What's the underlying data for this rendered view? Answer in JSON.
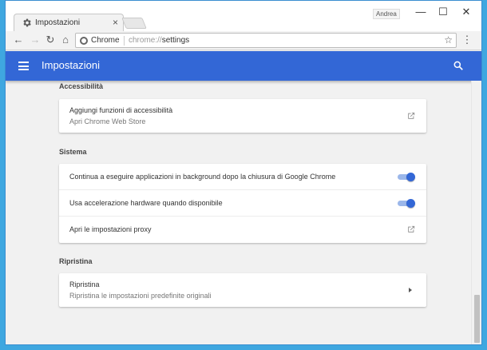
{
  "tab": {
    "title": "Impostazioni",
    "close": "×"
  },
  "window": {
    "profile": "Andrea",
    "minimize": "—",
    "maximize": "☐",
    "close": "✕"
  },
  "toolbar": {
    "back": "←",
    "forward": "→",
    "reload": "↻",
    "home": "⌂",
    "menu": "⋮"
  },
  "omnibox": {
    "site_name": "Chrome",
    "url_scheme": "chrome://",
    "url_path": "settings",
    "star": "☆"
  },
  "appbar": {
    "title": "Impostazioni"
  },
  "sections": {
    "accessibility": {
      "title": "Accessibilità",
      "item": {
        "label": "Aggiungi funzioni di accessibilità",
        "sub": "Apri Chrome Web Store"
      }
    },
    "system": {
      "title": "Sistema",
      "items": [
        {
          "label": "Continua a eseguire applicazioni in background dopo la chiusura di Google Chrome",
          "enabled": true
        },
        {
          "label": "Usa accelerazione hardware quando disponibile",
          "enabled": true
        },
        {
          "label": "Apri le impostazioni proxy"
        }
      ]
    },
    "reset": {
      "title": "Ripristina",
      "item": {
        "label": "Ripristina",
        "sub": "Ripristina le impostazioni predefinite originali"
      }
    }
  },
  "colors": {
    "accent": "#3367d6",
    "toggle_track": "#9bb7ea",
    "desktop": "#3fa7e0"
  }
}
